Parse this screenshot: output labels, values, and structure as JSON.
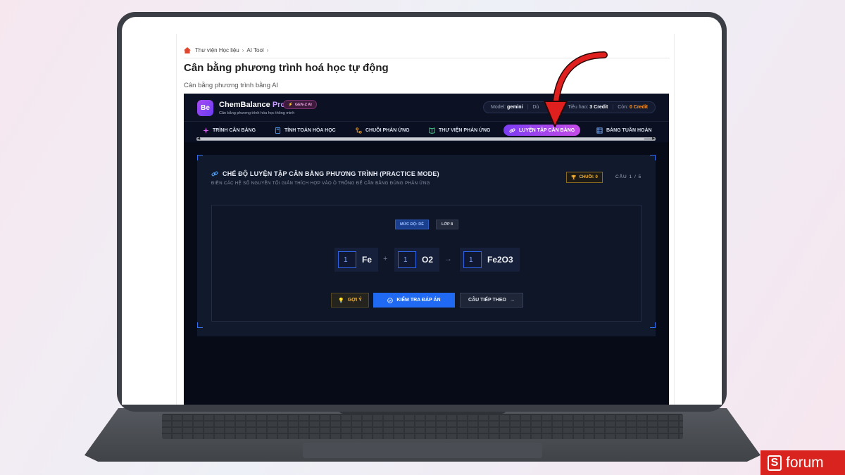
{
  "breadcrumb": {
    "items": [
      "Thư viện Học liệu",
      "AI Tool"
    ],
    "separator": "›"
  },
  "page": {
    "title": "Cân bằng phương trình hoá học tự động",
    "subtitle": "Cân bằng phương trình bằng AI"
  },
  "app": {
    "logo_text": "Be",
    "brand_main": "ChemBalance",
    "brand_pro": "Pro",
    "badge": "GEN-Z AI",
    "brand_sub": "Cân bằng phương trình hóa học thông minh",
    "model_label": "Model:",
    "model_value": "gemini",
    "model_extra": "Dù",
    "consume_label": "Tiêu hao:",
    "consume_value": "3 Credit",
    "remain_label": "Còn:",
    "remain_value": "0 Credit"
  },
  "tabs": [
    {
      "label": "TRÌNH CÂN BẰNG",
      "icon": "sparkle-icon",
      "active": false
    },
    {
      "label": "TÍNH TOÁN HÓA HỌC",
      "icon": "calculator-icon",
      "active": false
    },
    {
      "label": "CHUỖI PHẢN ỨNG",
      "icon": "chain-icon",
      "active": false
    },
    {
      "label": "THƯ VIỆN PHẢN ỨNG",
      "icon": "book-icon",
      "active": false
    },
    {
      "label": "LUYỆN TẬP CÂN BẰNG",
      "icon": "link-icon",
      "active": true
    },
    {
      "label": "BẢNG TUẦN HOÀN",
      "icon": "grid-icon",
      "active": false
    }
  ],
  "practice": {
    "title": "CHẾ ĐỘ LUYỆN TẬP CÂN BẰNG PHƯƠNG TRÌNH (PRACTICE MODE)",
    "description": "ĐIỀN CÁC HỆ SỐ NGUYÊN TỐI GIẢN THÍCH HỢP VÀO Ô TRỐNG ĐỂ CÂN BẰNG ĐÚNG PHẢN ỨNG",
    "streak": "CHUỖI: 0",
    "question": "CÂU 1 / 5",
    "level": "MỨC ĐỘ: DỄ",
    "grade": "LỚP 8",
    "equation": {
      "terms": [
        {
          "coef": "1",
          "formula": "Fe"
        },
        {
          "coef": "1",
          "formula": "O2"
        },
        {
          "coef": "1",
          "formula": "Fe2O3"
        }
      ],
      "plus": "+",
      "arrow": "→"
    },
    "buttons": {
      "hint": "GỢI Ý",
      "check": "KIỂM TRA ĐÁP ÁN",
      "next": "CÂU TIẾP THEO"
    }
  },
  "watermark": {
    "letter": "S",
    "word": "forum"
  },
  "colors": {
    "accent_blue": "#1f69f3",
    "active_tab_start": "#7b3cf2",
    "active_tab_end": "#c64ce7",
    "arrow_red": "#e0201e",
    "credit_orange": "#ff9a2e",
    "streak_gold": "#f2b53a"
  }
}
